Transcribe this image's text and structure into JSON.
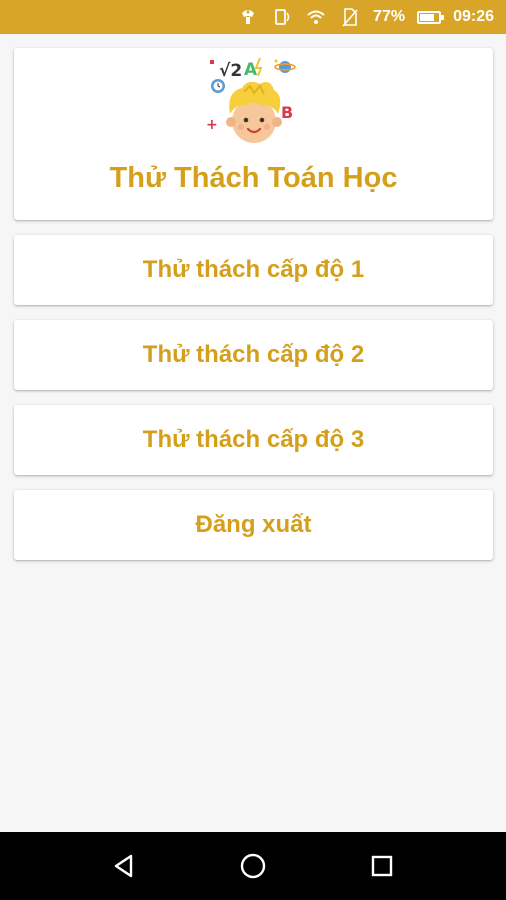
{
  "status_bar": {
    "battery_percent": "77%",
    "battery_level": 0.77,
    "time": "09:26",
    "icons": [
      "notification-icon",
      "nfc-icon",
      "wifi-icon",
      "no-sim-icon",
      "battery-icon"
    ],
    "background_color": "#d9a528"
  },
  "header": {
    "logo_icon": "math-kid-logo-icon",
    "title": "Thử Thách Toán Học"
  },
  "menu": {
    "level1_label": "Thử thách cấp độ 1",
    "level2_label": "Thử thách cấp độ 2",
    "level3_label": "Thử thách cấp độ 3",
    "logout_label": "Đăng xuất"
  },
  "nav_bar": {
    "icons": [
      "back-icon",
      "home-icon",
      "recents-icon"
    ]
  },
  "colors": {
    "accent": "#d4a01c",
    "card_background": "#ffffff",
    "page_background": "#f6f6f6"
  }
}
